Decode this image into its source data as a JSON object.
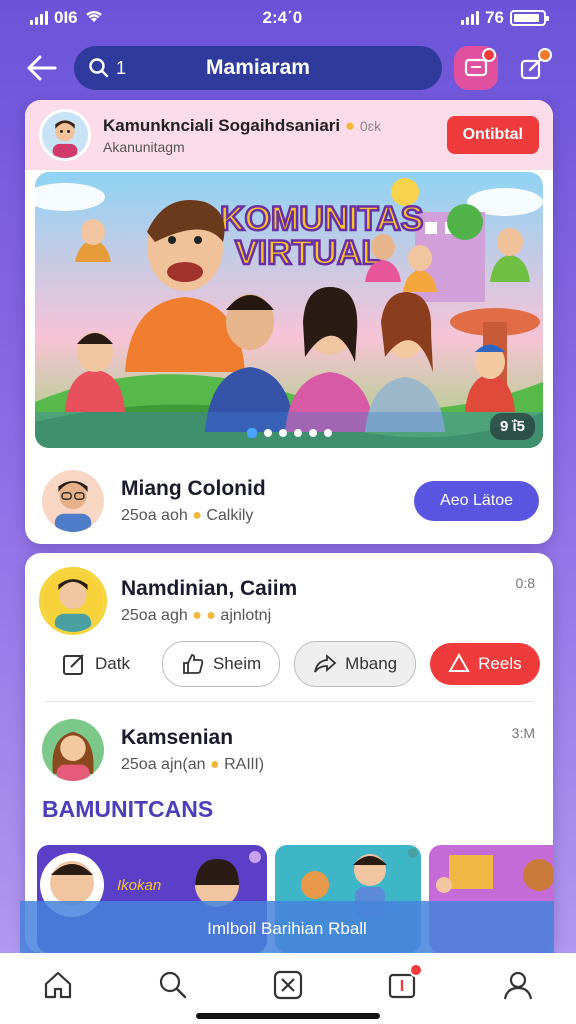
{
  "status": {
    "time": "2:4΄0",
    "carrier": "0Ι6",
    "network": "76",
    "battery_level": 0.9
  },
  "header": {
    "search_text": "1",
    "title": "Mamiaram"
  },
  "feature_card": {
    "title": "Kamunknciali Sogaihdsaniari",
    "title_suffix": "0ɛk",
    "subtitle": "Akanunitagm",
    "follow_label": "Ontibtal",
    "banner": {
      "headline_line1": "KOMUNITAS",
      "headline_line2": "VIRTUAL",
      "counter": "9 ΐ5",
      "slides": 6,
      "active_slide": 0
    },
    "author_name": "Miang Colonid",
    "author_meta": "25oa aoh",
    "author_meta_tail": "Calkily",
    "join_label": "Aeo Lätoe"
  },
  "feed": {
    "post1": {
      "name": "Namdinian, Caiim",
      "meta": "25oa agh",
      "meta_tail": "ajnlotnj",
      "time": "0:8",
      "actions": {
        "dark": "Datk",
        "share": "Sheim",
        "mong": "Mbang",
        "react": "Reels"
      }
    },
    "post2": {
      "name": "Kamsenian",
      "meta": "25oa ajn(an",
      "meta_tail": "RAIlI)",
      "time": "3:M"
    },
    "section_title": "BAMUNITCANS",
    "thumbs": [
      {
        "label": "Ikokan"
      },
      {
        "label": ""
      },
      {
        "label": ""
      }
    ]
  },
  "toast": {
    "text": "Imlboil Barihian Rball"
  },
  "colors": {
    "accent": "#5a55e0",
    "alert": "#ef3b3b",
    "brand_purple": "#4a3fb8"
  }
}
